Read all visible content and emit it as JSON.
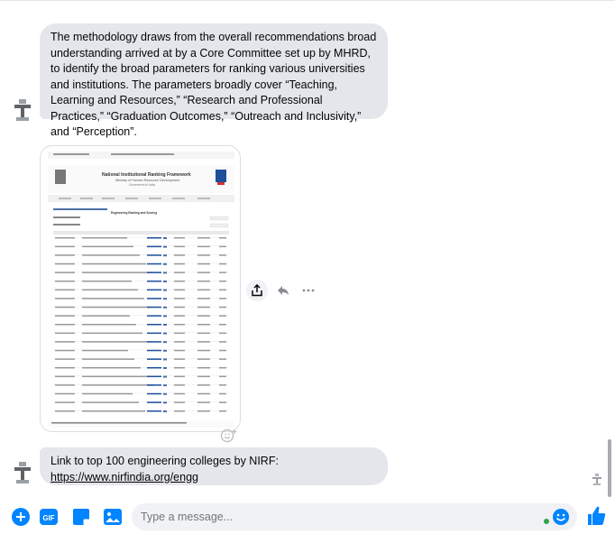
{
  "messages": [
    {
      "type": "text",
      "text": "The methodology draws from the overall recommendations broad understanding arrived at by a Core Committee set up by MHRD, to identify the broad parameters for ranking various universities and institutions. The parameters broadly cover “Teaching, Learning and Resources,” “Research and Professional Practices,” “Graduation Outcomes,” “Outreach and Inclusivity,” and “Perception”."
    },
    {
      "type": "image",
      "alt": "NIRF screenshot",
      "doc": {
        "title": "National Institutional Ranking Framework",
        "subtitle": "Ministry of Human Resource Development",
        "sub2": "Government of India",
        "heading": "Engineering Ranking and Scoring"
      }
    },
    {
      "type": "text",
      "line1": "Link to top 100 engineering colleges by NIRF:",
      "link": "https://www.nirfindia.org/engg"
    }
  ],
  "composer": {
    "placeholder": "Type a message..."
  },
  "colors": {
    "accent": "#0084ff",
    "bubble": "#e4e6eb",
    "online": "#31a24c"
  },
  "icons": [
    "plus-circle-icon",
    "gif-icon",
    "sticker-icon",
    "image-icon",
    "emoji-icon",
    "like-icon",
    "share-icon",
    "reply-icon",
    "more-icon",
    "avatar-icon"
  ]
}
